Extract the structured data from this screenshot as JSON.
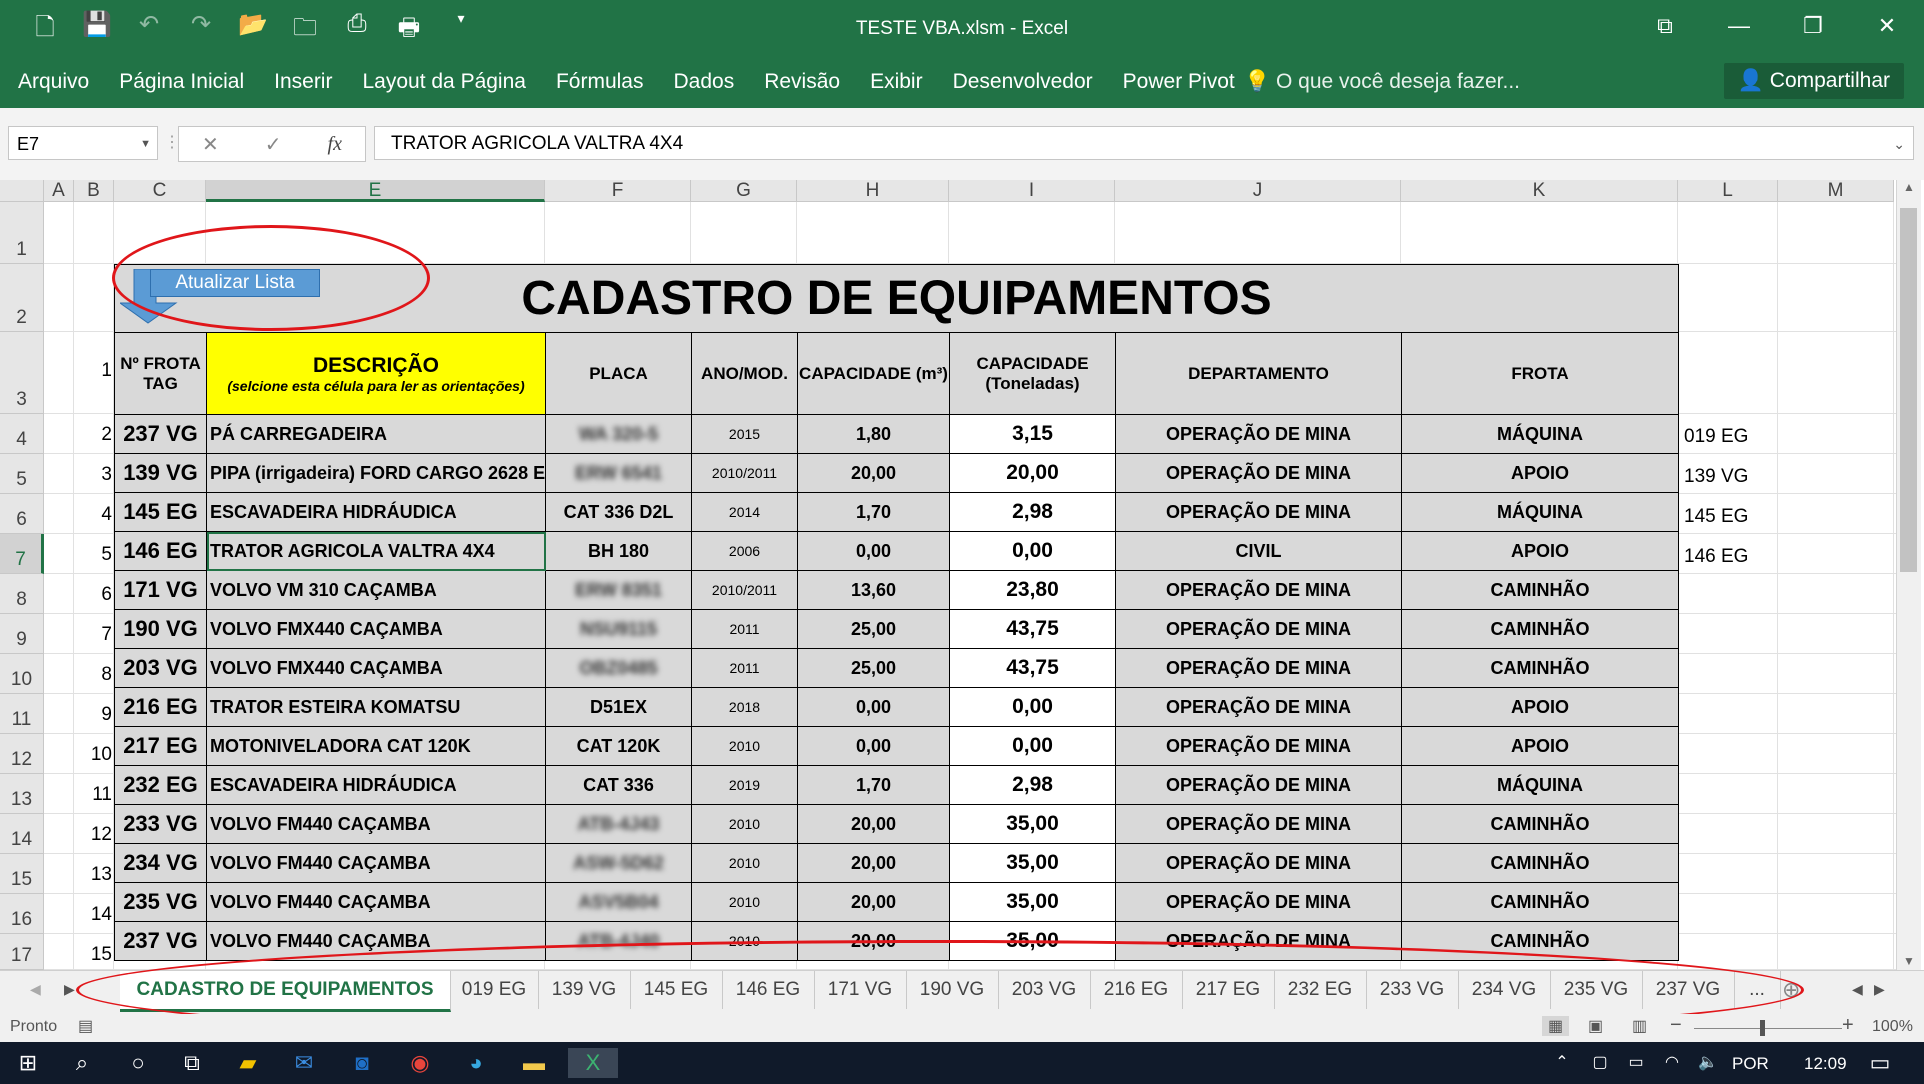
{
  "window": {
    "title": "TESTE VBA.xlsm - Excel",
    "qat_icons": [
      "new-file-icon",
      "save-icon",
      "undo-icon",
      "redo-icon",
      "open-icon",
      "folder-icon",
      "export-icon",
      "print-icon",
      "customize-icon"
    ]
  },
  "ribbon": {
    "tabs": [
      "Arquivo",
      "Página Inicial",
      "Inserir",
      "Layout da Página",
      "Fórmulas",
      "Dados",
      "Revisão",
      "Exibir",
      "Desenvolvedor",
      "Power Pivot"
    ],
    "tell_me": "O que você deseja fazer...",
    "share": "Compartilhar"
  },
  "formula_bar": {
    "name_box": "E7",
    "fx": "fx",
    "value": "TRATOR AGRICOLA VALTRA 4X4"
  },
  "columns": [
    "A",
    "B",
    "C",
    "E",
    "F",
    "G",
    "H",
    "I",
    "J",
    "K",
    "L",
    "M"
  ],
  "rows": [
    "1",
    "2",
    "3",
    "4",
    "5",
    "6",
    "7",
    "8",
    "9",
    "10",
    "11",
    "12",
    "13",
    "14",
    "15",
    "16",
    "17"
  ],
  "sheet": {
    "button_label": "Atualizar Lista",
    "title": "CADASTRO DE EQUIPAMENTOS",
    "header_index": "1",
    "headers": {
      "tag": "Nº FROTA TAG",
      "desc": "DESCRIÇÃO",
      "desc_note": "(selcione esta célula para ler as orientações)",
      "placa": "PLACA",
      "ano": "ANO/MOD.",
      "cap_m3": "CAPACIDADE (m³)",
      "cap_ton": "CAPACIDADE (Toneladas)",
      "dept": "DEPARTAMENTO",
      "frota": "FROTA"
    },
    "rows": [
      {
        "idx": "2",
        "tag": "237 VG",
        "desc": "PÁ CARREGADEIRA",
        "placa": "WA 320-5",
        "ano": "2015",
        "m3": "1,80",
        "ton": "3,15",
        "dept": "OPERAÇÃO DE MINA",
        "frota": "MÁQUINA",
        "side": "019 EG"
      },
      {
        "idx": "3",
        "tag": "139 VG",
        "desc": "PIPA (irrigadeira)  FORD CARGO 2628 E",
        "placa": "ERW 6541",
        "ano": "2010/2011",
        "m3": "20,00",
        "ton": "20,00",
        "dept": "OPERAÇÃO DE MINA",
        "frota": "APOIO",
        "side": "139 VG"
      },
      {
        "idx": "4",
        "tag": "145 EG",
        "desc": "ESCAVADEIRA HIDRÁUDICA",
        "placa": "CAT 336 D2L",
        "ano": "2014",
        "m3": "1,70",
        "ton": "2,98",
        "dept": "OPERAÇÃO DE MINA",
        "frota": "MÁQUINA",
        "side": "145 EG"
      },
      {
        "idx": "5",
        "tag": "146 EG",
        "desc": "TRATOR AGRICOLA VALTRA 4X4",
        "placa": "BH 180",
        "ano": "2006",
        "m3": "0,00",
        "ton": "0,00",
        "dept": "CIVIL",
        "frota": "APOIO",
        "side": "146 EG"
      },
      {
        "idx": "6",
        "tag": "171 VG",
        "desc": "VOLVO VM 310 CAÇAMBA",
        "placa": "ERW 8351",
        "ano": "2010/2011",
        "m3": "13,60",
        "ton": "23,80",
        "dept": "OPERAÇÃO DE MINA",
        "frota": "CAMINHÃO",
        "side": ""
      },
      {
        "idx": "7",
        "tag": "190 VG",
        "desc": "VOLVO FMX440 CAÇAMBA",
        "placa": "NSU9115",
        "ano": "2011",
        "m3": "25,00",
        "ton": "43,75",
        "dept": "OPERAÇÃO DE MINA",
        "frota": "CAMINHÃO",
        "side": ""
      },
      {
        "idx": "8",
        "tag": "203 VG",
        "desc": "VOLVO FMX440 CAÇAMBA",
        "placa": "OBZ0485",
        "ano": "2011",
        "m3": "25,00",
        "ton": "43,75",
        "dept": "OPERAÇÃO DE MINA",
        "frota": "CAMINHÃO",
        "side": ""
      },
      {
        "idx": "9",
        "tag": "216 EG",
        "desc": "TRATOR ESTEIRA KOMATSU",
        "placa": "D51EX",
        "ano": "2018",
        "m3": "0,00",
        "ton": "0,00",
        "dept": "OPERAÇÃO DE MINA",
        "frota": "APOIO",
        "side": ""
      },
      {
        "idx": "10",
        "tag": "217 EG",
        "desc": "MOTONIVELADORA CAT 120K",
        "placa": "CAT 120K",
        "ano": "2010",
        "m3": "0,00",
        "ton": "0,00",
        "dept": "OPERAÇÃO DE MINA",
        "frota": "APOIO",
        "side": ""
      },
      {
        "idx": "11",
        "tag": "232 EG",
        "desc": "ESCAVADEIRA HIDRÁUDICA",
        "placa": "CAT 336",
        "ano": "2019",
        "m3": "1,70",
        "ton": "2,98",
        "dept": "OPERAÇÃO DE MINA",
        "frota": "MÁQUINA",
        "side": ""
      },
      {
        "idx": "12",
        "tag": "233 VG",
        "desc": "VOLVO FM440 CAÇAMBA",
        "placa": "ATB-4J43",
        "ano": "2010",
        "m3": "20,00",
        "ton": "35,00",
        "dept": "OPERAÇÃO DE MINA",
        "frota": "CAMINHÃO",
        "side": ""
      },
      {
        "idx": "13",
        "tag": "234 VG",
        "desc": "VOLVO FM440 CAÇAMBA",
        "placa": "ASW-5D62",
        "ano": "2010",
        "m3": "20,00",
        "ton": "35,00",
        "dept": "OPERAÇÃO DE MINA",
        "frota": "CAMINHÃO",
        "side": ""
      },
      {
        "idx": "14",
        "tag": "235 VG",
        "desc": "VOLVO FM440 CAÇAMBA",
        "placa": "ASV5B04",
        "ano": "2010",
        "m3": "20,00",
        "ton": "35,00",
        "dept": "OPERAÇÃO DE MINA",
        "frota": "CAMINHÃO",
        "side": ""
      },
      {
        "idx": "15",
        "tag": "237 VG",
        "desc": "VOLVO FM440 CAÇAMBA",
        "placa": "ATB-4J40",
        "ano": "2010",
        "m3": "20,00",
        "ton": "35,00",
        "dept": "OPERAÇÃO DE MINA",
        "frota": "CAMINHÃO",
        "side": ""
      }
    ]
  },
  "sheet_tabs": [
    "CADASTRO DE EQUIPAMENTOS",
    "019 EG",
    "139 VG",
    "145 EG",
    "146 EG",
    "171 VG",
    "190 VG",
    "203 VG",
    "216 EG",
    "217 EG",
    "232 EG",
    "233 VG",
    "234 VG",
    "235 VG",
    "237 VG",
    "..."
  ],
  "status": {
    "ready": "Pronto",
    "zoom": "100%"
  },
  "taskbar": {
    "lang": "POR",
    "time": "12:09"
  },
  "colors": {
    "excel_green": "#217346",
    "header_yellow": "#ffff00",
    "annotation_red": "#e0161a",
    "button_blue": "#5b9bd5"
  }
}
